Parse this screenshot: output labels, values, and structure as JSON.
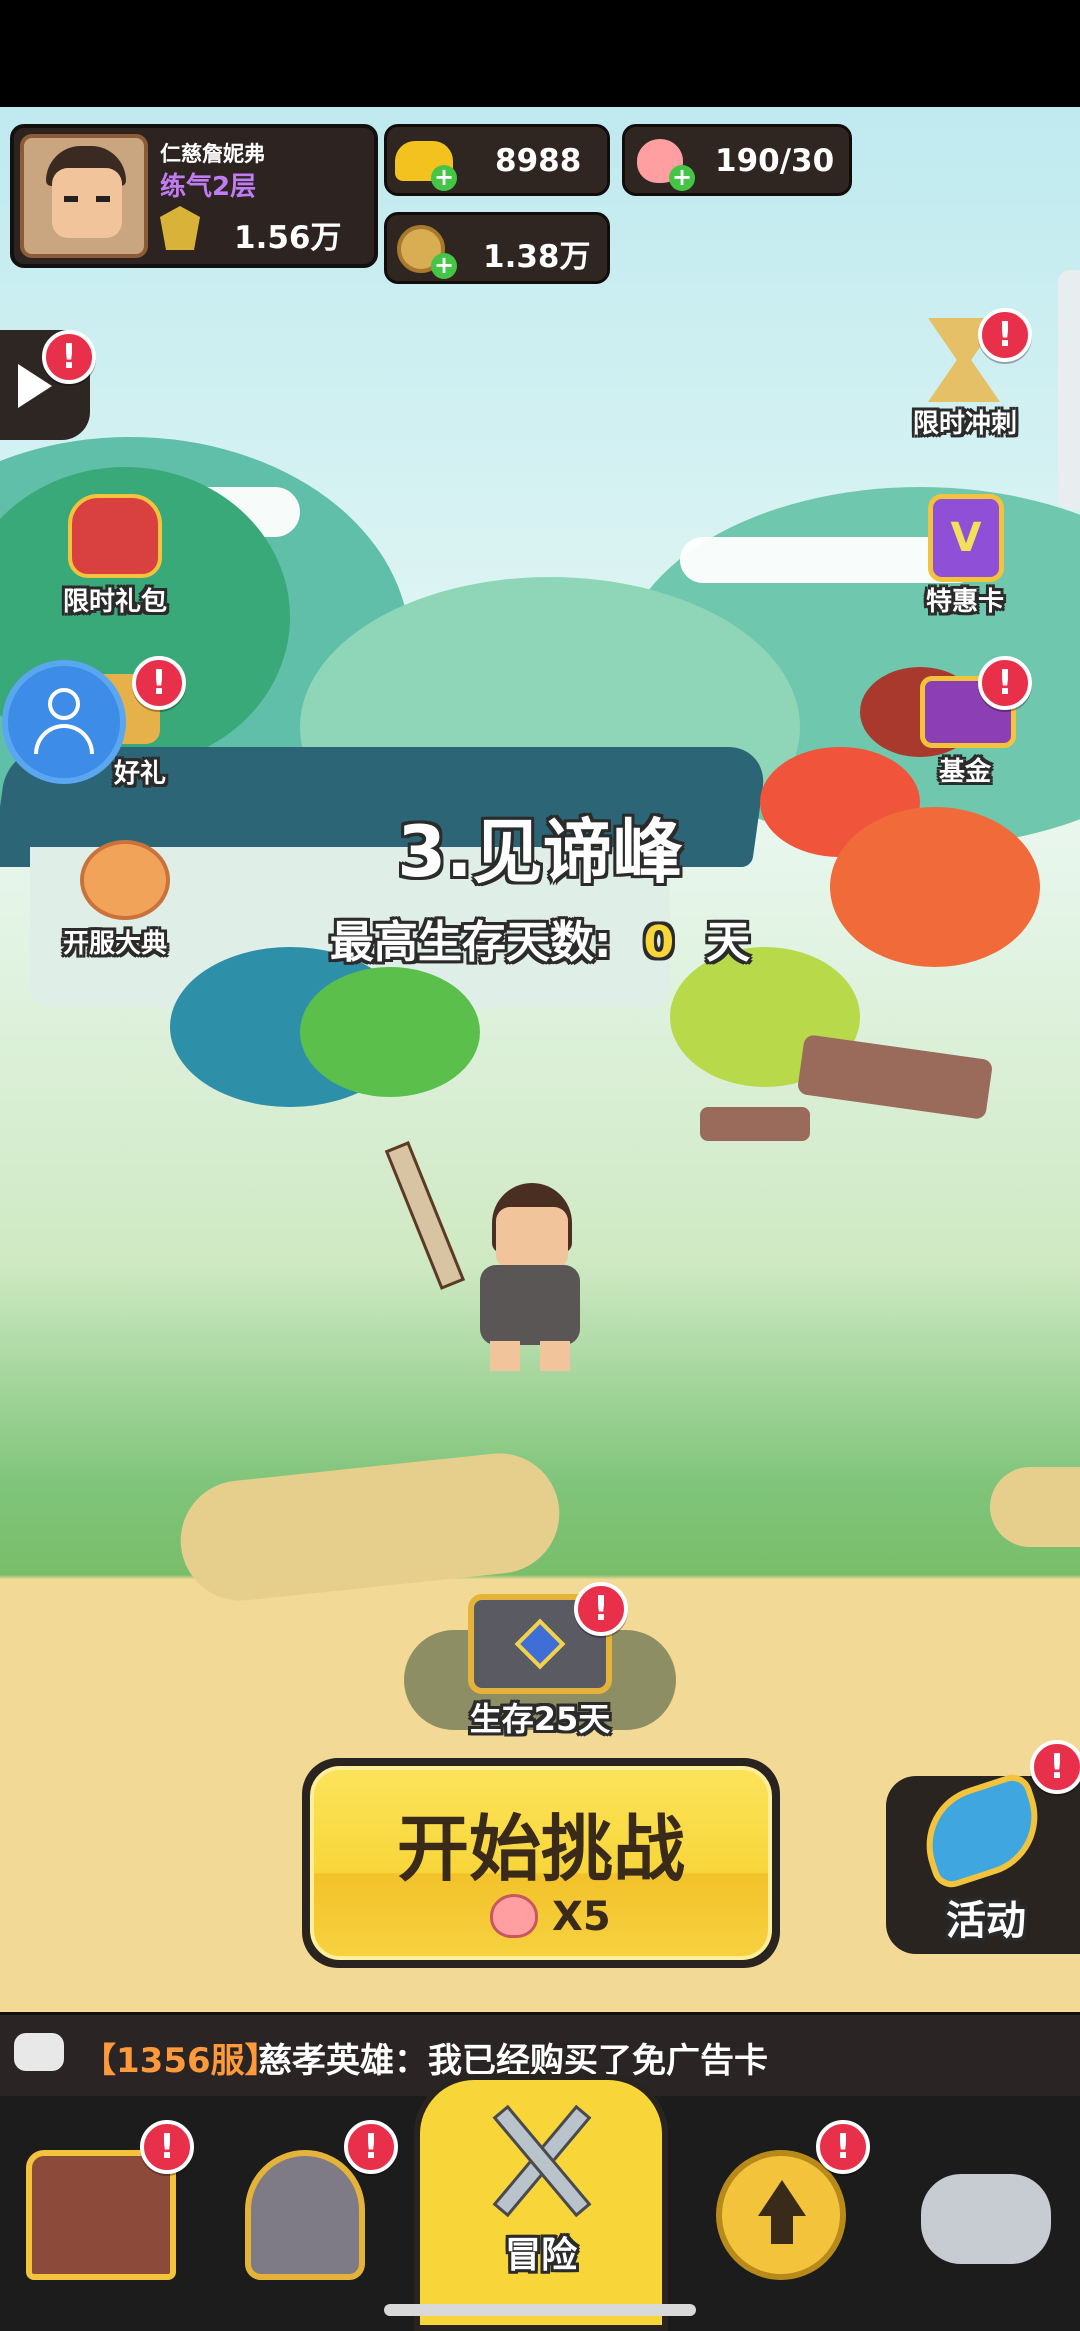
{
  "player": {
    "name": "仁慈詹妮弗",
    "rank": "练气2层",
    "power": "1.56万"
  },
  "resources": {
    "gold": "8988",
    "stamina": "190/30",
    "coins": "1.38万"
  },
  "left_icons": [
    {
      "label": "限时礼包"
    },
    {
      "label": "好礼"
    },
    {
      "label": "开服大典"
    }
  ],
  "right_icons": [
    {
      "label": "限时冲刺"
    },
    {
      "label": "特惠卡"
    },
    {
      "label": "基金"
    }
  ],
  "stage": {
    "title": "3.见谛峰",
    "survival_prefix": "最高生存天数:",
    "survival_days": "0",
    "survival_suffix": "天"
  },
  "chest": {
    "label": "生存25天"
  },
  "start_button": {
    "label": "开始挑战",
    "cost": "X5"
  },
  "activity": {
    "label": "活动"
  },
  "chat": {
    "server": "【1356服】",
    "text": "慈孝英雄：我已经购买了免广告卡"
  },
  "nav": {
    "adventure_label": "冒险"
  },
  "badge_mark": "!",
  "colors": {
    "accent_yellow": "#f8d63a",
    "badge_red": "#e8304a",
    "rank_purple": "#c07cf2",
    "chat_orange": "#ff9a3c"
  }
}
